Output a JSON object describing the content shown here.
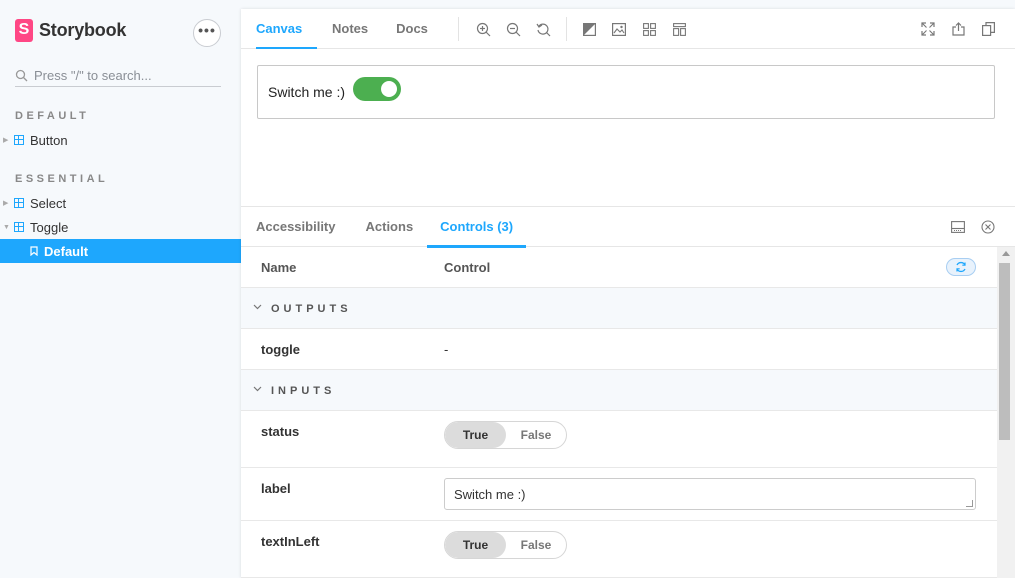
{
  "app": {
    "brand": "Storybook",
    "menu_glyph": "•••"
  },
  "search": {
    "placeholder": "Press \"/\" to search..."
  },
  "sidebar": {
    "groups": [
      {
        "label": "DEFAULT",
        "items": [
          {
            "label": "Button"
          }
        ]
      },
      {
        "label": "ESSENTIAL",
        "items": [
          {
            "label": "Select"
          },
          {
            "label": "Toggle"
          }
        ]
      }
    ],
    "selected_story": "Default"
  },
  "toolbar": {
    "tabs": [
      {
        "label": "Canvas"
      },
      {
        "label": "Notes"
      },
      {
        "label": "Docs"
      }
    ],
    "active_tab": "Canvas",
    "icons": [
      "zoom-in-icon",
      "zoom-out-icon",
      "zoom-reset-icon",
      "contrast-icon",
      "image-icon",
      "grid-icon",
      "outline-icon",
      "fullscreen-icon",
      "share-icon",
      "copy-icon"
    ]
  },
  "preview": {
    "label": "Switch me :)",
    "toggle_on": true,
    "accent": "#4caf50"
  },
  "addons": {
    "tabs": [
      {
        "label": "Accessibility"
      },
      {
        "label": "Actions"
      },
      {
        "label": "Controls (3)"
      }
    ],
    "active_tab": "Controls (3)"
  },
  "controls": {
    "header": {
      "name": "Name",
      "control": "Control"
    },
    "sections": [
      {
        "label": "OUTPUTS",
        "rows": [
          {
            "name": "toggle",
            "value": "-"
          }
        ]
      },
      {
        "label": "INPUTS",
        "rows": [
          {
            "name": "status",
            "type": "boolean",
            "true_label": "True",
            "false_label": "False",
            "value": true
          },
          {
            "name": "label",
            "type": "text",
            "value": "Switch me :)"
          },
          {
            "name": "textInLeft",
            "type": "boolean",
            "true_label": "True",
            "false_label": "False",
            "value": true
          }
        ]
      }
    ]
  },
  "colors": {
    "accent": "#1ea7fd",
    "brand": "#ff4785"
  }
}
